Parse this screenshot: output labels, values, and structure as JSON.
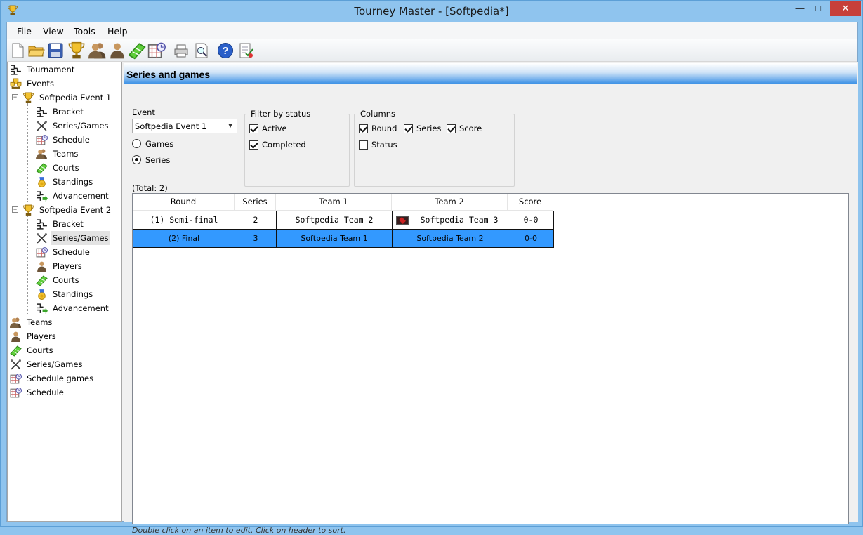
{
  "window": {
    "title": "Tourney Master - [Softpedia*]",
    "controls": {
      "minimize": "—",
      "maximize": "□",
      "close": "✕"
    }
  },
  "menu": {
    "items": [
      {
        "label": "File"
      },
      {
        "label": "View"
      },
      {
        "label": "Tools"
      },
      {
        "label": "Help"
      }
    ]
  },
  "toolbar": {
    "buttons": [
      {
        "icon": "new-file-icon"
      },
      {
        "icon": "open-folder-icon"
      },
      {
        "icon": "save-icon"
      },
      {
        "icon": "trophy-icon"
      },
      {
        "icon": "teams-icon"
      },
      {
        "icon": "player-icon"
      },
      {
        "icon": "courts-icon"
      },
      {
        "icon": "schedule-icon"
      },
      {
        "icon": "print-icon"
      },
      {
        "icon": "print-preview-icon"
      },
      {
        "icon": "help-icon"
      },
      {
        "icon": "report-icon"
      }
    ]
  },
  "sidebar": {
    "items": [
      {
        "label": "Tournament"
      },
      {
        "label": "Events"
      },
      {
        "label": "Softpedia Event 1"
      },
      {
        "label": "Bracket"
      },
      {
        "label": "Series/Games"
      },
      {
        "label": "Schedule"
      },
      {
        "label": "Teams"
      },
      {
        "label": "Courts"
      },
      {
        "label": "Standings"
      },
      {
        "label": "Advancement"
      },
      {
        "label": "Softpedia Event 2"
      },
      {
        "label": "Bracket"
      },
      {
        "label": "Series/Games"
      },
      {
        "label": "Schedule"
      },
      {
        "label": "Players"
      },
      {
        "label": "Courts"
      },
      {
        "label": "Standings"
      },
      {
        "label": "Advancement"
      },
      {
        "label": "Teams"
      },
      {
        "label": "Players"
      },
      {
        "label": "Courts"
      },
      {
        "label": "Series/Games"
      },
      {
        "label": "Schedule games"
      },
      {
        "label": "Schedule"
      }
    ]
  },
  "main": {
    "header": "Series and games",
    "event": {
      "label": "Event",
      "selected": "Softpedia Event 1"
    },
    "view_mode": {
      "games": "Games",
      "series": "Series",
      "selected": "Series"
    },
    "filter": {
      "title": "Filter by status",
      "active": {
        "label": "Active",
        "checked": true
      },
      "completed": {
        "label": "Completed",
        "checked": true
      }
    },
    "columns": {
      "title": "Columns",
      "round": {
        "label": "Round",
        "checked": true
      },
      "series": {
        "label": "Series",
        "checked": true
      },
      "score": {
        "label": "Score",
        "checked": true
      },
      "status": {
        "label": "Status",
        "checked": false
      }
    },
    "total": "(Total: 2)",
    "table": {
      "headers": [
        "Round",
        "Series",
        "Team 1",
        "Team 2",
        "Score"
      ],
      "rows": [
        {
          "round": "(1) Semi-final",
          "series": "2",
          "team1": "Softpedia Team 2",
          "team2": "Softpedia Team 3",
          "score": "0-0"
        },
        {
          "round": "(2) Final",
          "series": "3",
          "team1": "Softpedia Team 1",
          "team2": "Softpedia Team 2",
          "score": "0-0"
        }
      ]
    },
    "hint": "Double click on an item to edit. Click on header to sort."
  }
}
